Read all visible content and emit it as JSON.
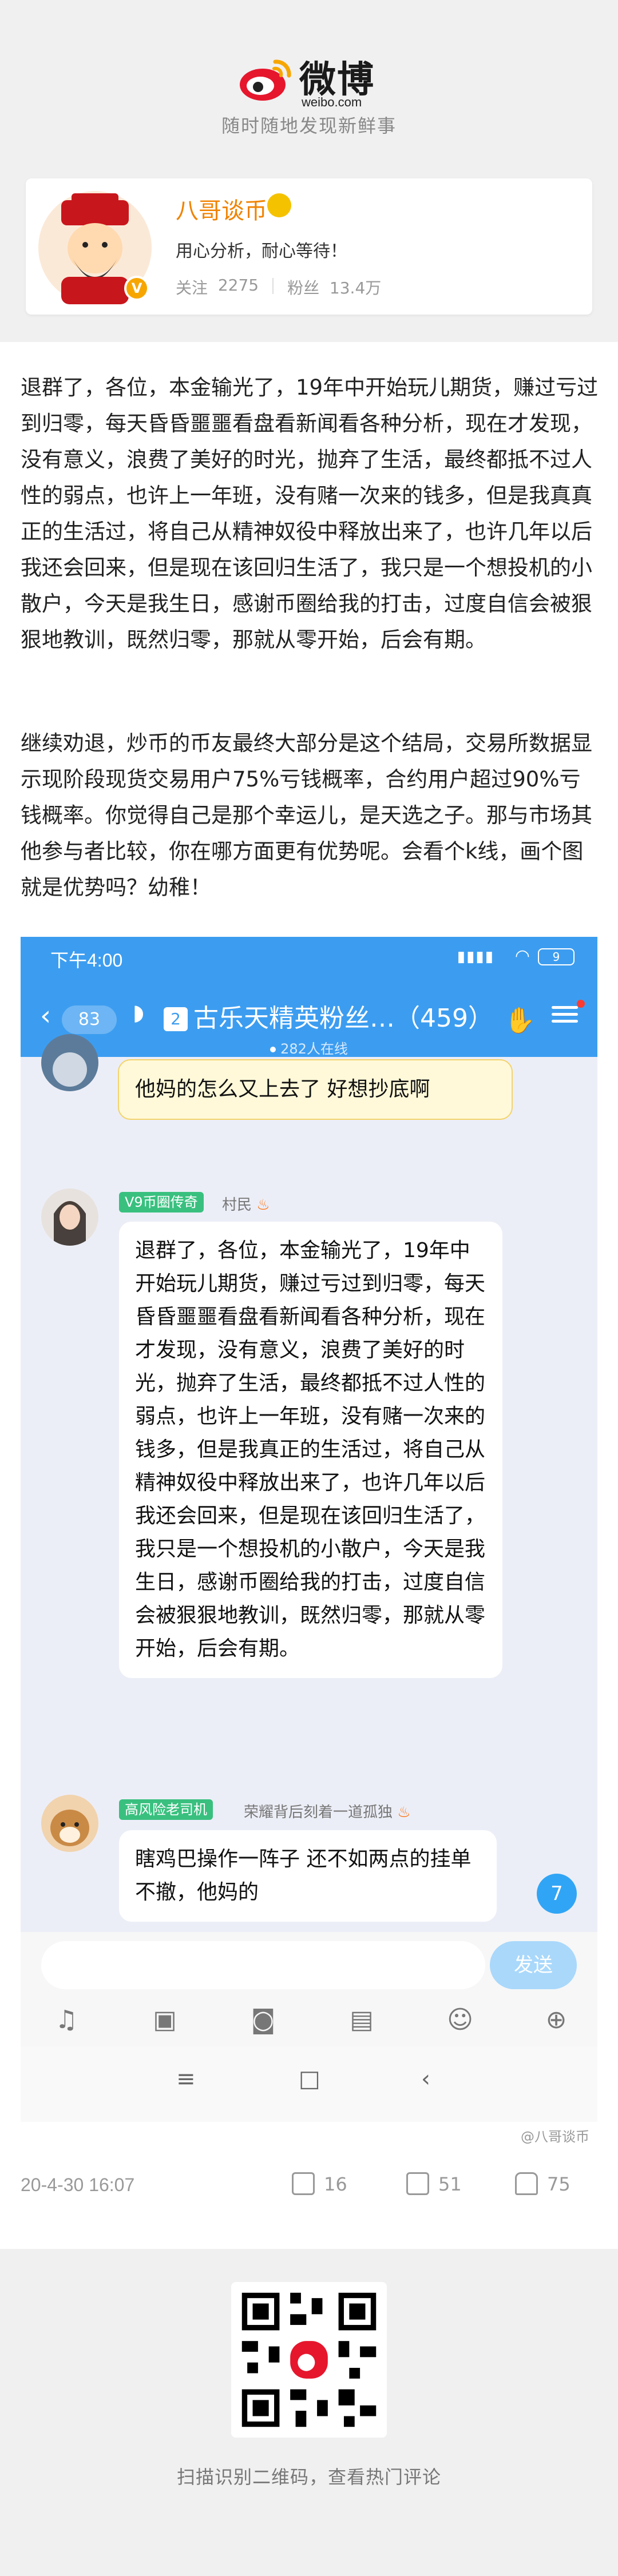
{
  "header": {
    "brand": "微博",
    "domain": "weibo.com",
    "slogan": "随时随地发现新鲜事"
  },
  "profile": {
    "name": "八哥谈币",
    "bio": "用心分析，耐心等待！",
    "follow_label": "关注",
    "follow_count": "2275",
    "fans_label": "粉丝",
    "fans_count": "13.4万",
    "badge": "V"
  },
  "post": {
    "paragraph1": "退群了，各位，本金输光了，19年中开始玩儿期货，赚过亏过到归零，每天昏昏噩噩看盘看新闻看各种分析，现在才发现，没有意义，浪费了美好的时光，抛弃了生活，最终都抵不过人性的弱点，也许上一年班，没有赌一次来的钱多，但是我真真正的生活过，将自己从精神奴役中释放出来了，也许几年以后我还会回来，但是现在该回归生活了，我只是一个想投机的小散户，今天是我生日，感谢币圈给我的打击，过度自信会被狠狠地教训，既然归零，那就从零开始，后会有期。",
    "paragraph2": "继续劝退，炒币的币友最终大部分是这个结局，交易所数据显示现阶段现货交易用户75%亏钱概率，合约用户超过90%亏钱概率。你觉得自己是那个幸运儿，是天选之子。那与市场其他参与者比较，你在哪方面更有优势呢。会看个k线，画个图就是优势吗？幼稚！",
    "screenshot_credit": "@八哥谈币",
    "time": "20-4-30 16:07",
    "shares": "16",
    "comments": "51",
    "likes": "75"
  },
  "chat": {
    "status_time": "下午4:00",
    "battery": "9",
    "back_count": "83",
    "group_num": "2",
    "group_title": "古乐天精英粉丝…（459）",
    "online": "282人在线",
    "msg1_text": "他妈的怎么又上去了 好想抄底啊",
    "msg2_tag": "V9币圈传奇",
    "msg2_role": "村民",
    "msg2_text": "退群了，各位，本金输光了，19年中开始玩儿期货，赚过亏过到归零，每天昏昏噩噩看盘看新闻看各种分析，现在才发现，没有意义，浪费了美好的时光，抛弃了生活，最终都抵不过人性的弱点，也许上一年班，没有赌一次来的钱多，但是我真正的生活过，将自己从精神奴役中释放出来了，也许几年以后我还会回来，但是现在该回归生活了，我只是一个想投机的小散户，今天是我生日，感谢币圈给我的打击，过度自信会被狠狠地教训，既然归零，那就从零开始，后会有期。",
    "msg3_tag": "高风险老司机",
    "msg3_role": "荣耀背后刻着一道孤独",
    "msg3_text": "瞎鸡巴操作一阵子 还不如两点的挂单不撤，他妈的",
    "unread": "7",
    "send_label": "发送"
  },
  "qr": {
    "caption": "扫描识别二维码，查看热门评论"
  },
  "colors": {
    "weibo_orange": "#f08300",
    "chat_blue": "#3c9df0",
    "tag_green": "#39c07f"
  }
}
